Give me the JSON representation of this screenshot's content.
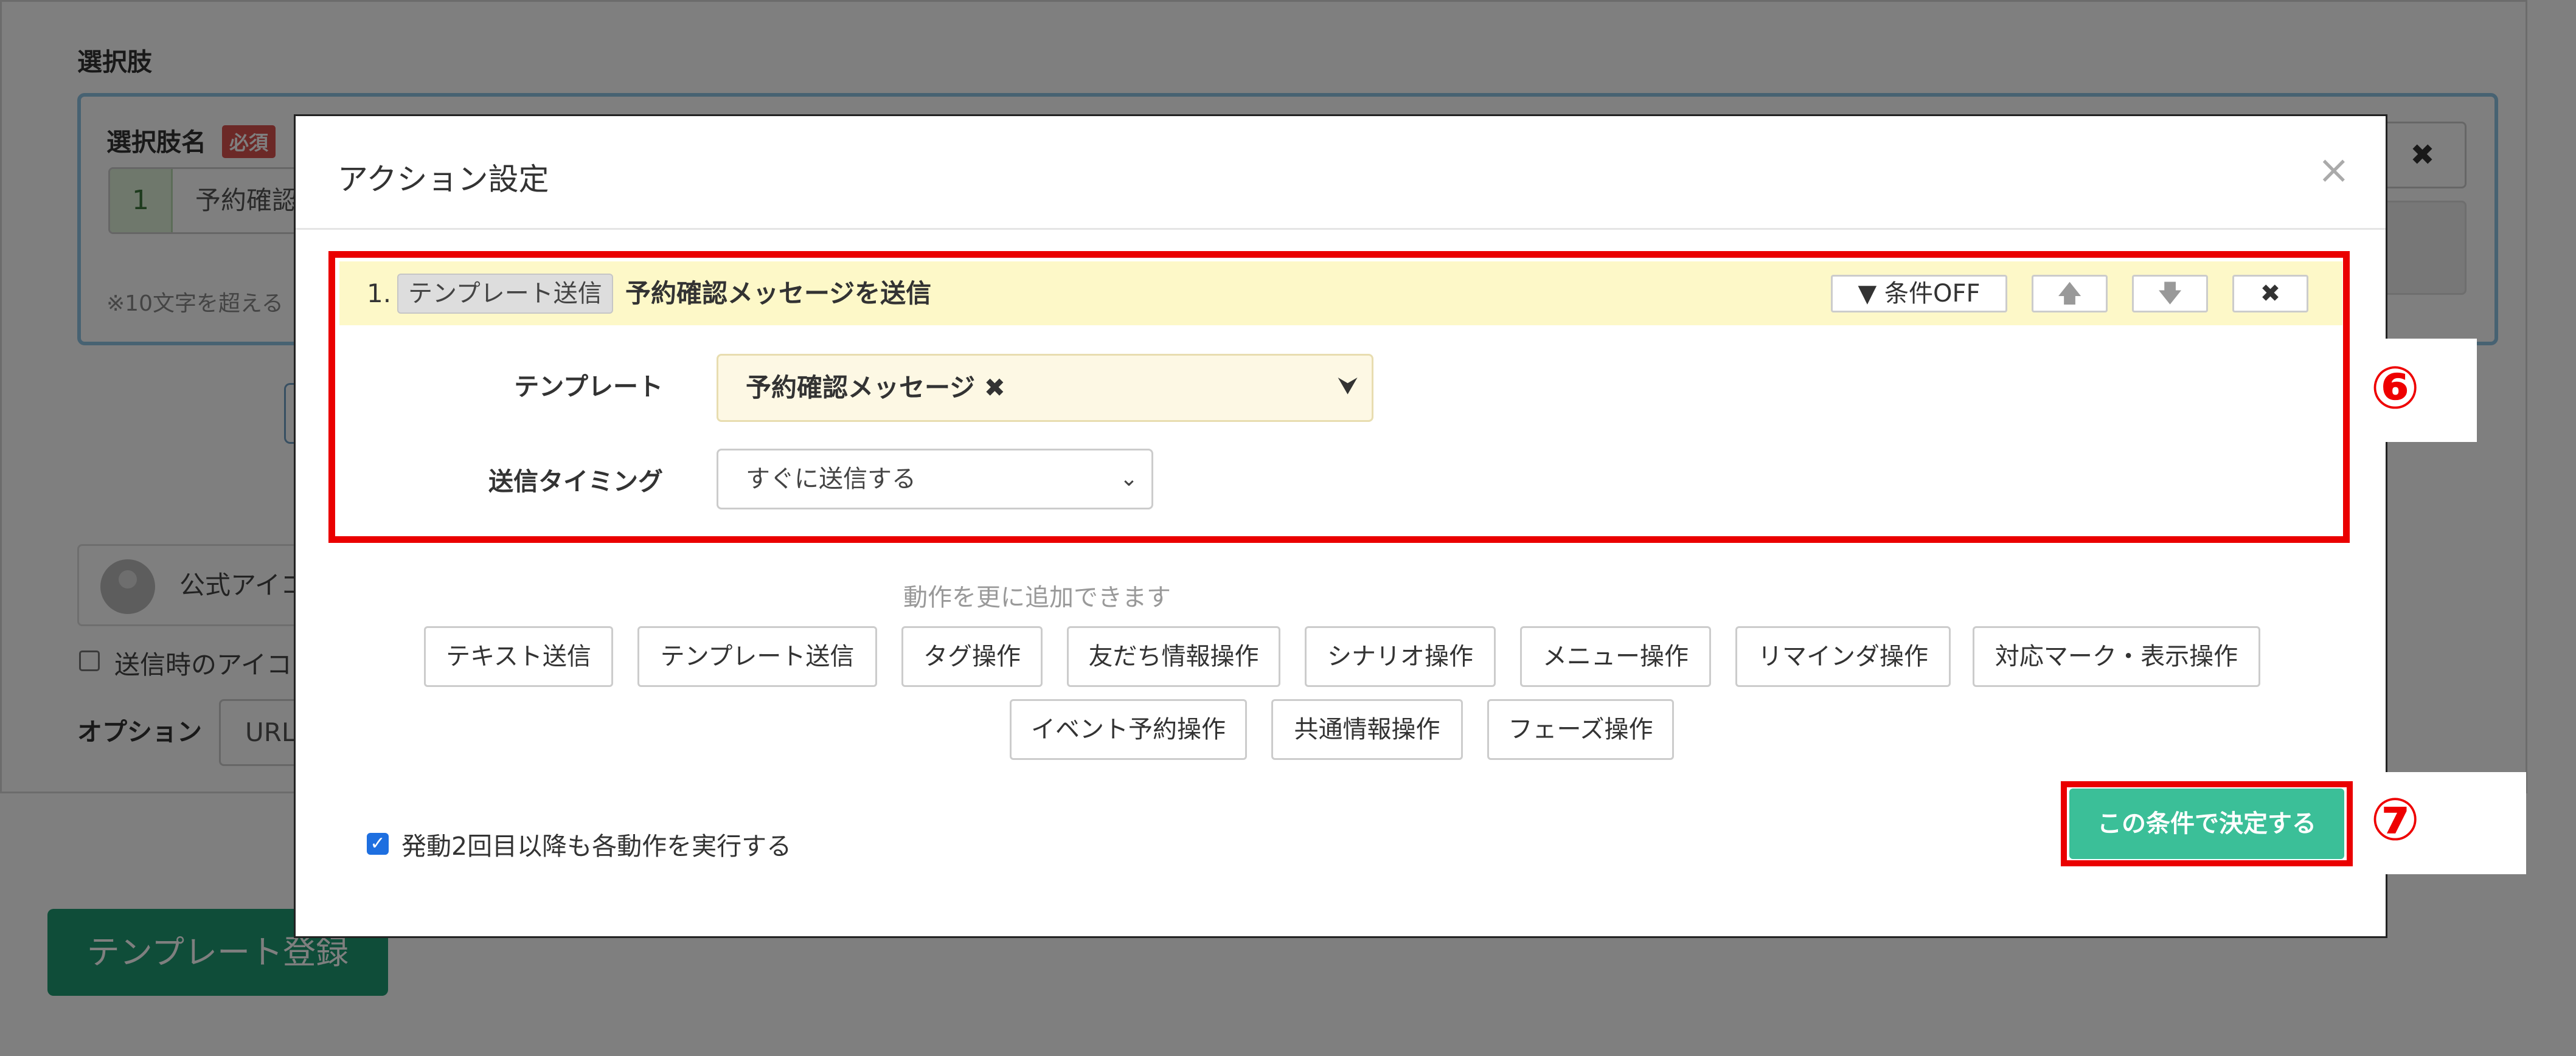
{
  "background": {
    "section_label": "選択肢",
    "choice_name_label": "選択肢名",
    "required_badge": "必須",
    "choice_number": "1",
    "choice_text": "予約確認",
    "char_note": "※10文字を超える",
    "official_icon_text": "公式アイコ",
    "send_icon_checkbox_label": "送信時のアイコ",
    "option_label": "オプション",
    "url_input_text": "URL",
    "register_button": "テンプレート登録",
    "delete_icon": "✖"
  },
  "modal": {
    "title": "アクション設定",
    "close_icon": "×",
    "action": {
      "number": "1.",
      "type_badge": "テンプレート送信",
      "name": "予約確認メッセージを送信",
      "condition_button": "条件OFF",
      "condition_icon": "▼",
      "up_icon": "🡅",
      "down_icon": "🡇",
      "delete_icon": "✖"
    },
    "fields": {
      "template_label": "テンプレート",
      "template_value": "予約確認メッセージ",
      "template_clear_icon": "✖",
      "template_chevron": "⌄",
      "timing_label": "送信タイミング",
      "timing_value": "すぐに送信する",
      "timing_chevron": "⌄"
    },
    "add_hint": "動作を更に追加できます",
    "operations_row1": [
      "テキスト送信",
      "テンプレート送信",
      "タグ操作",
      "友だち情報操作",
      "シナリオ操作",
      "メニュー操作",
      "リマインダ操作",
      "対応マーク・表示操作"
    ],
    "operations_row2": [
      "イベント予約操作",
      "共通情報操作",
      "フェーズ操作"
    ],
    "repeat_checkbox_label": "発動2回目以降も各動作を実行する",
    "repeat_checked": true,
    "confirm_button": "この条件で決定する"
  },
  "callouts": {
    "step6": "⑥",
    "step7": "⑦"
  },
  "colors": {
    "highlight": "#ea0000",
    "confirm": "#3bbf98",
    "register": "#1e9b73",
    "action_header": "#fdf8c8"
  }
}
